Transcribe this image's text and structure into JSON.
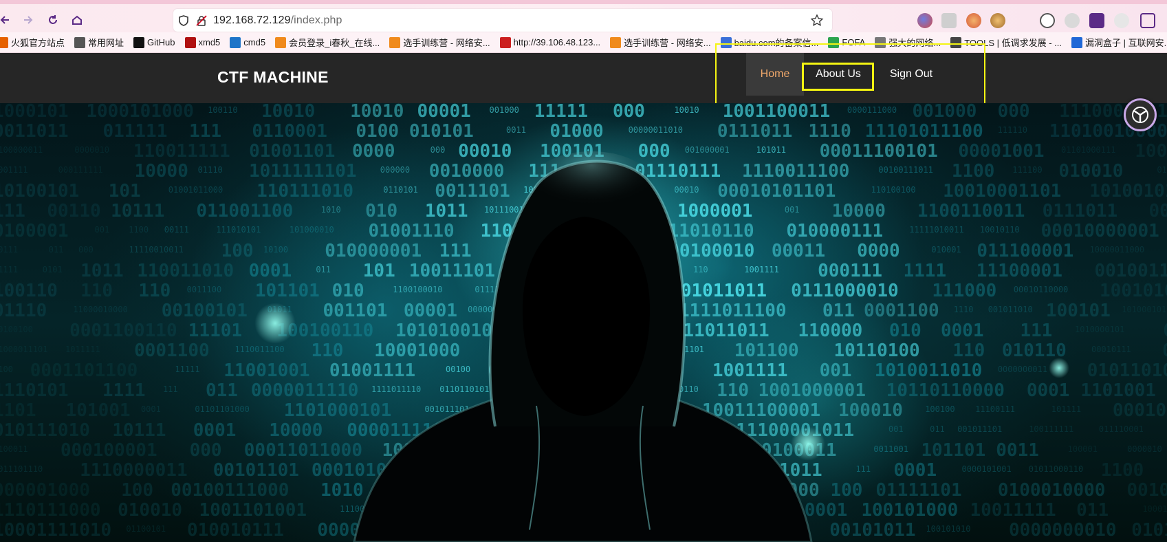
{
  "browser": {
    "url_host": "192.168.72.129",
    "url_path": "/index.php",
    "bookmarks": [
      {
        "label": "火狐官方站点",
        "color": "#e66000"
      },
      {
        "label": "常用网址",
        "color": "#555555"
      },
      {
        "label": "GitHub",
        "color": "#111111"
      },
      {
        "label": "xmd5",
        "color": "#b01010"
      },
      {
        "label": "cmd5",
        "color": "#1e74c8"
      },
      {
        "label": "会员登录_i春秋_在线...",
        "color": "#f08a1c"
      },
      {
        "label": "选手训练营 - 网络安...",
        "color": "#f08a1c"
      },
      {
        "label": "http://39.106.48.123...",
        "color": "#cc1f1f"
      },
      {
        "label": "选手训练营 - 网络安...",
        "color": "#f08a1c"
      },
      {
        "label": "baidu.com的备案信...",
        "color": "#3b6fd8"
      },
      {
        "label": "FOFA",
        "color": "#2da44e"
      },
      {
        "label": "强大的网络...",
        "color": "#777777"
      },
      {
        "label": "TOOLS | 低调求发展 - ...",
        "color": "#444444"
      },
      {
        "label": "漏洞盒子 | 互联网安...",
        "color": "#1f67d6"
      }
    ]
  },
  "site": {
    "brand": "CTF MACHINE",
    "nav": {
      "home": "Home",
      "about": "About Us",
      "signout": "Sign Out"
    },
    "accent_color": "#f0a86b",
    "highlight_color": "#f4f412"
  }
}
